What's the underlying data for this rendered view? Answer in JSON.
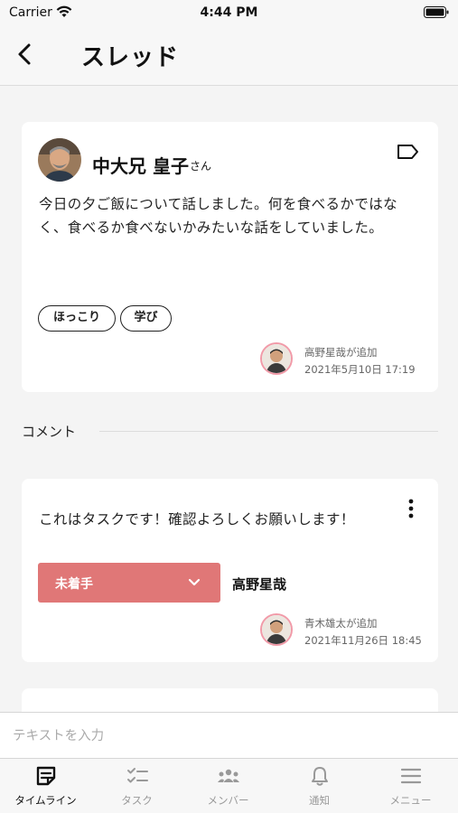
{
  "status_bar": {
    "carrier": "Carrier",
    "time": "4:44 PM"
  },
  "nav": {
    "title": "スレッド"
  },
  "post": {
    "author": "中大兄 皇子",
    "author_suffix": "さん",
    "body": "今日の夕ご飯について話しました。何を食べるかではなく、食べるか食べないかみたいな話をしていました。",
    "tags": [
      "ほっこり",
      "学び"
    ],
    "added_by": "高野星哉が追加",
    "added_date": "2021年5月10日 17:19"
  },
  "comments_section": {
    "label": "コメント"
  },
  "comment": {
    "text": "これはタスクです！確認よろしくお願いします！",
    "status": "未着手",
    "assignee": "高野星哉",
    "added_by": "青木雄太が追加",
    "added_date": "2021年11月26日 18:45"
  },
  "input": {
    "placeholder": "テキストを入力"
  },
  "tabs": [
    {
      "label": "タイムライン",
      "icon": "timeline-icon",
      "active": true
    },
    {
      "label": "タスク",
      "icon": "task-icon",
      "active": false
    },
    {
      "label": "メンバー",
      "icon": "members-icon",
      "active": false
    },
    {
      "label": "通知",
      "icon": "bell-icon",
      "active": false
    },
    {
      "label": "メニュー",
      "icon": "menu-icon",
      "active": false
    }
  ],
  "colors": {
    "status_select": "#e07777",
    "avatar_ring": "#f19aa8",
    "active_tab": "#111111",
    "inactive_tab": "#999999"
  }
}
